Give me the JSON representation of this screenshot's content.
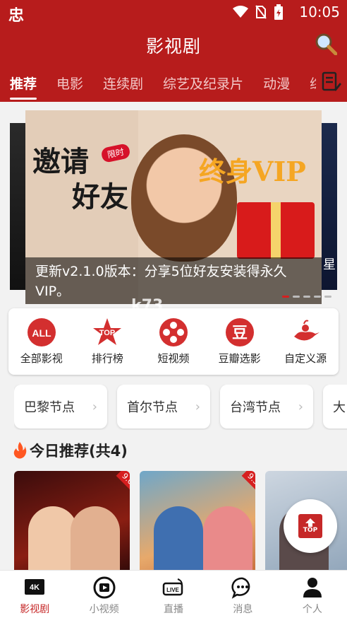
{
  "status_bar": {
    "app_glyph": "忠",
    "time": "10:05"
  },
  "header": {
    "title": "影视剧"
  },
  "tabs": [
    {
      "label": "推荐",
      "active": true
    },
    {
      "label": "电影"
    },
    {
      "label": "连续剧"
    },
    {
      "label": "综艺及纪录片"
    },
    {
      "label": "动漫"
    },
    {
      "label": "综"
    }
  ],
  "banner": {
    "invite_line1": "邀请",
    "invite_line2": "好友",
    "limit_badge": "限时",
    "vip_text": "终身VIP",
    "caption": "更新v2.1.0版本：分享5位好友安装得永久VIP。",
    "side_right_text": "星"
  },
  "watermark": "k73",
  "categories": [
    {
      "label": "全部影视",
      "icon": "all-icon"
    },
    {
      "label": "排行榜",
      "icon": "top-rank-icon"
    },
    {
      "label": "短视频",
      "icon": "film-reel-icon"
    },
    {
      "label": "豆瓣选影",
      "icon": "douban-icon"
    },
    {
      "label": "自定义源",
      "icon": "genie-lamp-icon"
    }
  ],
  "nodes": [
    {
      "label": "巴黎节点"
    },
    {
      "label": "首尔节点"
    },
    {
      "label": "台湾节点"
    },
    {
      "label": "大"
    }
  ],
  "section": {
    "title": "今日推荐(共4)"
  },
  "posters": [
    {
      "score": "9.0"
    },
    {
      "score": "9.3"
    },
    {
      "score": ""
    }
  ],
  "top_button": {
    "label": "TOP"
  },
  "bottom_nav": [
    {
      "label": "影视剧",
      "icon": "4k-icon",
      "active": true
    },
    {
      "label": "小视频",
      "icon": "play-circle-icon"
    },
    {
      "label": "直播",
      "icon": "live-icon"
    },
    {
      "label": "消息",
      "icon": "chat-bubble-icon"
    },
    {
      "label": "个人",
      "icon": "person-icon"
    }
  ],
  "colors": {
    "brand_red": "#b71c1c",
    "accent_red": "#c62828",
    "active_dot": "#d61f1f"
  }
}
